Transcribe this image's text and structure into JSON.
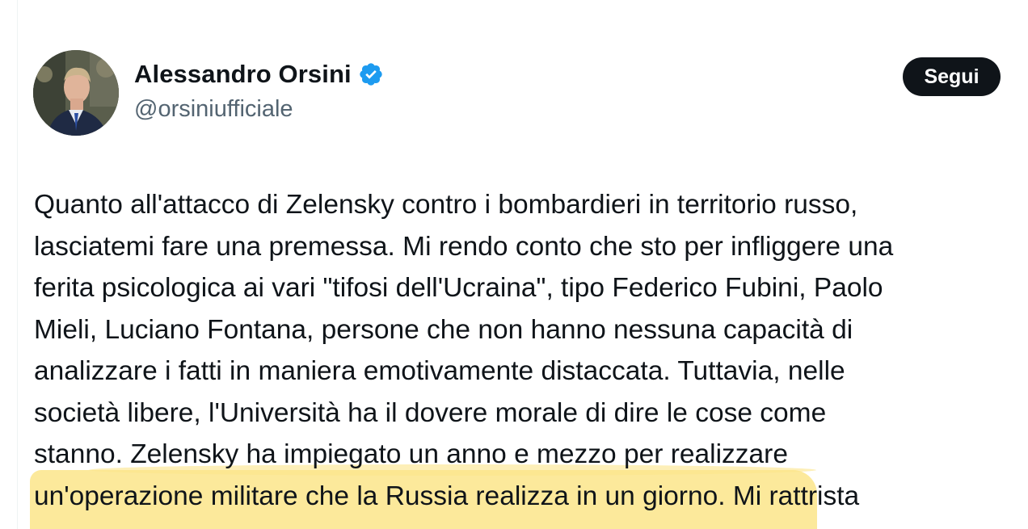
{
  "author": {
    "display_name": "Alessandro Orsini",
    "handle": "@orsiniufficiale",
    "verified_icon": "verified-badge-icon",
    "verified_color": "#1d9bf0"
  },
  "actions": {
    "follow_label": "Segui"
  },
  "tweet": {
    "lines": [
      "Quanto all'attacco di Zelensky contro i bombardieri in territorio russo,",
      "lasciatemi fare una premessa. Mi rendo conto che sto per infliggere una",
      "ferita psicologica ai vari \"tifosi dell'Ucraina\", tipo Federico Fubini, Paolo",
      "Mieli, Luciano Fontana, persone che non hanno nessuna capacità di",
      "analizzare i fatti in maniera emotivamente distaccata. Tuttavia, nelle",
      "società libere, l'Università ha il dovere morale di dire le cose come",
      "stanno. Zelensky ha impiegato un anno e mezzo per realizzare",
      "un'operazione militare che la Russia realizza in un giorno. Mi rattrista"
    ],
    "highlight_color": "#fbe58a"
  }
}
